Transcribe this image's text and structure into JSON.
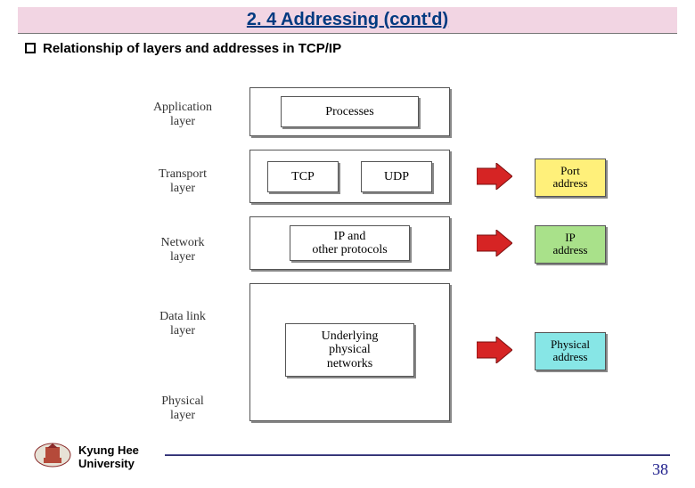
{
  "title": "2. 4 Addressing (cont'd)",
  "bullet": "Relationship of layers and addresses in TCP/IP",
  "layers": {
    "app": "Application\nlayer",
    "trans": "Transport\nlayer",
    "net": "Network\nlayer",
    "dlink": "Data link\nlayer",
    "phys": "Physical\nlayer"
  },
  "boxes": {
    "processes": "Processes",
    "tcp": "TCP",
    "udp": "UDP",
    "ip": "IP and\nother protocols",
    "phy": "Underlying\nphysical\nnetworks"
  },
  "addresses": {
    "port": "Port\naddress",
    "ip": "IP\naddress",
    "phys": "Physical\naddress"
  },
  "footer": {
    "uni": "Kyung Hee\nUniversity",
    "page": "38"
  }
}
